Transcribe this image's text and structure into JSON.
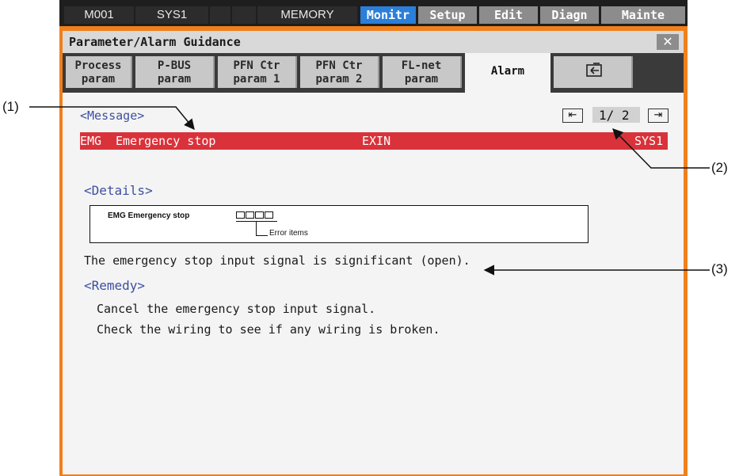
{
  "statusbar": {
    "program": "M001",
    "system": "SYS1",
    "mode": "MEMORY",
    "tabs": [
      "Monitr",
      "Setup",
      "Edit",
      "Diagn",
      "Mainte"
    ],
    "active_tab": "Monitr"
  },
  "window": {
    "title": "Parameter/Alarm Guidance",
    "close_glyph": "✕"
  },
  "param_tabs": [
    {
      "line1": "Process",
      "line2": "param"
    },
    {
      "line1": "P-BUS",
      "line2": "param"
    },
    {
      "line1": "PFN Ctr",
      "line2": "param 1"
    },
    {
      "line1": "PFN Ctr",
      "line2": "param 2"
    },
    {
      "line1": "FL-net",
      "line2": "param"
    },
    {
      "line1": "Alarm",
      "line2": ""
    }
  ],
  "tab_icon": "folder-back-icon",
  "message": {
    "heading": "<Message>",
    "page": "1/ 2",
    "alarm": {
      "code": "EMG",
      "text": "Emergency stop",
      "source": "EXIN",
      "system": "SYS1"
    }
  },
  "details": {
    "heading": "<Details>",
    "box_code": "EMG  Emergency stop",
    "box_label": "Error items",
    "text": "The emergency stop input signal is significant (open)."
  },
  "remedy": {
    "heading": "<Remedy>",
    "lines": [
      "Cancel the emergency stop input signal.",
      "Check the wiring to see if any wiring is broken."
    ]
  },
  "callouts": [
    "(1)",
    "(2)",
    "(3)"
  ],
  "colors": {
    "window_border": "#f07f1c",
    "alarm_bar": "#d9323a",
    "active_tab": "#2b7fd8",
    "heading_blue": "#3d4fa0"
  }
}
